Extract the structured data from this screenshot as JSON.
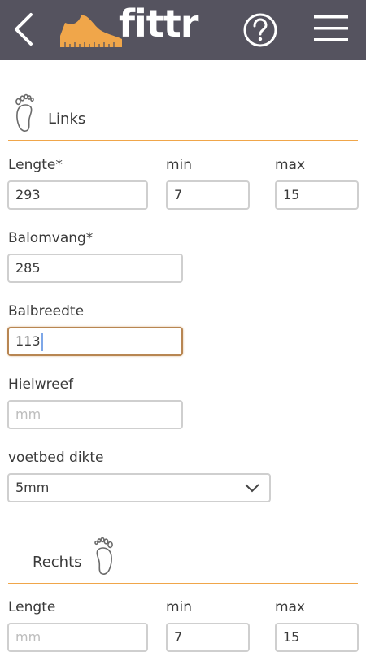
{
  "header": {
    "brand": "fittr",
    "colors": {
      "bar": "#55535f",
      "accent": "#f0a64a"
    }
  },
  "left": {
    "title": "Links",
    "lengte_label": "Lengte*",
    "min_label": "min",
    "max_label": "max",
    "lengte_value": "293",
    "min_value": "7",
    "max_value": "15",
    "balomvang_label": "Balomvang*",
    "balomvang_value": "285",
    "balbreedte_label": "Balbreedte",
    "balbreedte_value": "113",
    "hielwreef_label": "Hielwreef",
    "hielwreef_placeholder": "mm",
    "voetbed_label": "voetbed dikte",
    "voetbed_value": "5mm"
  },
  "right": {
    "title": "Rechts",
    "lengte_label": "Lengte",
    "min_label": "min",
    "max_label": "max",
    "lengte_placeholder": "mm",
    "min_value": "7",
    "max_value": "15"
  }
}
